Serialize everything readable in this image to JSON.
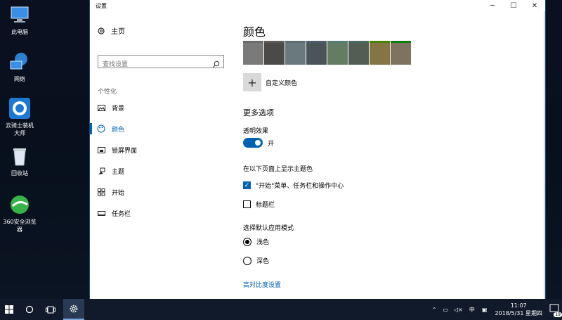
{
  "desktop": {
    "icons": [
      {
        "label": "此电脑"
      },
      {
        "label": "网络"
      },
      {
        "label": "云骑士装机\n大师"
      },
      {
        "label": "回收站"
      },
      {
        "label": "360安全浏览\n器"
      }
    ]
  },
  "window": {
    "title": "设置",
    "buttons": {
      "minimize": "─",
      "maximize": "☐",
      "close": "✕"
    }
  },
  "nav": {
    "home": "主页",
    "search_placeholder": "查找设置",
    "section": "个性化",
    "items": [
      {
        "label": "背景",
        "icon": "image-icon"
      },
      {
        "label": "颜色",
        "icon": "palette-icon",
        "active": true
      },
      {
        "label": "锁屏界面",
        "icon": "lock-screen-icon"
      },
      {
        "label": "主题",
        "icon": "theme-icon"
      },
      {
        "label": "开始",
        "icon": "start-icon"
      },
      {
        "label": "任务栏",
        "icon": "taskbar-icon"
      }
    ]
  },
  "main": {
    "title": "颜色",
    "swatches": [
      {
        "color": "#7a7a7a",
        "top": "#6b6b6b"
      },
      {
        "color": "#4c4a48",
        "top": "#5d5a58"
      },
      {
        "color": "#69797e",
        "top": "#5f6c72"
      },
      {
        "color": "#4a5459",
        "top": "#515c6b"
      },
      {
        "color": "#647c64",
        "top": "#567c73"
      },
      {
        "color": "#525e54",
        "top": "#486860"
      },
      {
        "color": "#847545",
        "top": "#498205"
      },
      {
        "color": "#7e735f",
        "top": "#107c10"
      }
    ],
    "custom_color": "自定义颜色",
    "more_options": "更多选项",
    "transparency_label": "透明效果",
    "transparency_state": "开",
    "accent_label": "在以下页面上显示主题色",
    "check_start": "\"开始\"菜单、任务栏和操作中心",
    "check_titlebar": "标题栏",
    "mode_label": "选择默认应用模式",
    "mode_light": "浅色",
    "mode_dark": "深色",
    "high_contrast": "高对比度设置"
  },
  "taskbar": {
    "tray_lang": "中",
    "time": "11:07",
    "date": "2018/5/31 星期四",
    "notif_count": "19"
  },
  "colors": {
    "accent": "#0063b1"
  }
}
